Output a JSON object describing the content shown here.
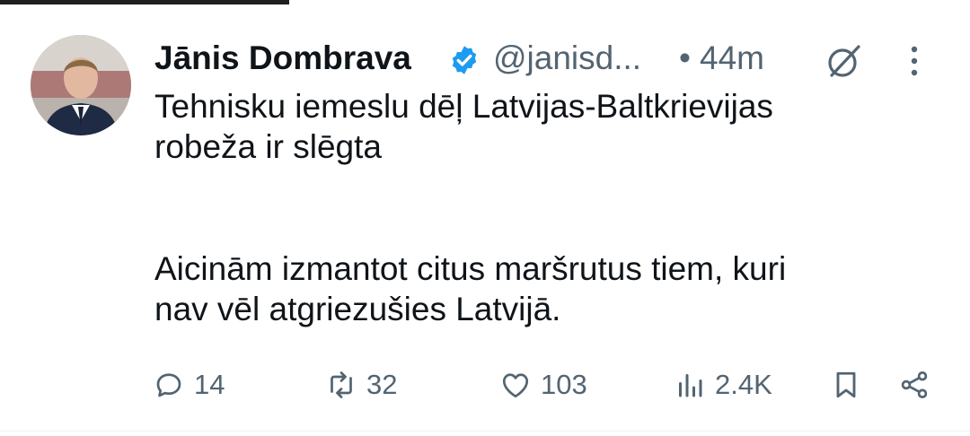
{
  "tweet": {
    "author_name": "Jānis Dombrava",
    "author_handle": "@janisd...",
    "separator": "•",
    "time": "44m",
    "text_paragraphs": [
      [
        "Tehnisku iemeslu dēļ Latvijas-Baltkrievijas",
        "robeža ir slēgta"
      ],
      [
        "Aicinām izmantot citus maršrutus tiem, kuri",
        "nav vēl atgriezušies Latvijā."
      ]
    ],
    "verified": true,
    "verified_color": "#1d9bf0"
  },
  "actions": {
    "replies": "14",
    "reposts": "32",
    "likes": "103",
    "views": "2.4K"
  },
  "icons": [
    "verified-badge-icon",
    "grok-icon",
    "more-icon",
    "reply-icon",
    "repost-icon",
    "like-icon",
    "views-icon",
    "bookmark-icon",
    "share-icon"
  ],
  "colors": {
    "text": "#0f1419",
    "secondary": "#536471",
    "accent": "#1d9bf0"
  }
}
